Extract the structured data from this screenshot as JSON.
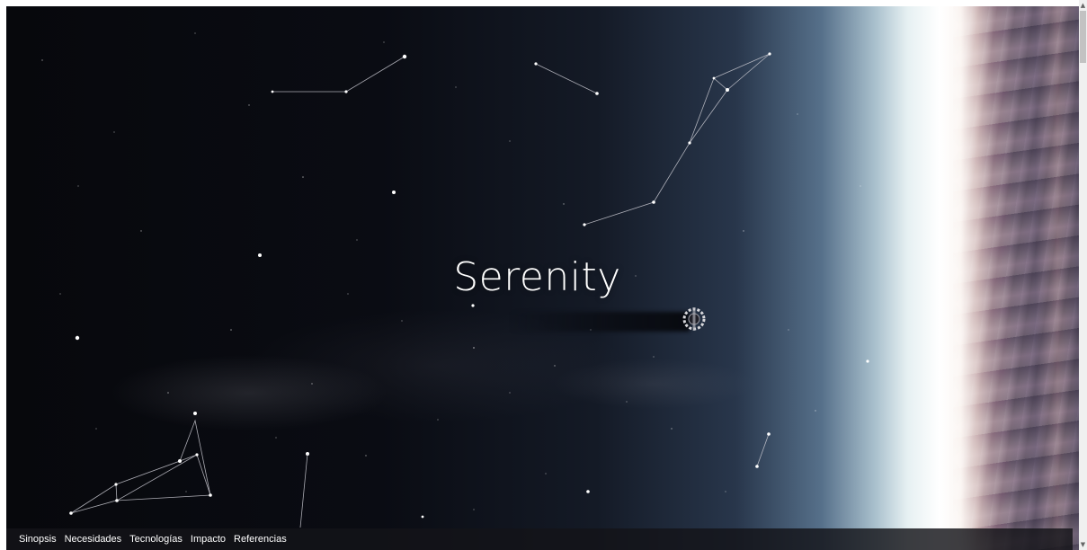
{
  "hero": {
    "title": "Serenity"
  },
  "nav": {
    "items": [
      {
        "label": "Sinopsis"
      },
      {
        "label": "Necesidades"
      },
      {
        "label": "Tecnologías"
      },
      {
        "label": "Impacto"
      },
      {
        "label": "Referencias"
      }
    ]
  },
  "colors": {
    "space": "#0a0b10",
    "nav_bg": "#141418",
    "text": "#ffffff",
    "constellation_line": "#c8c8d0"
  },
  "icons": {
    "spaceship": "spaceship-icon",
    "scroll_up": "scroll-up-arrow-icon",
    "scroll_down": "scroll-down-arrow-icon"
  }
}
